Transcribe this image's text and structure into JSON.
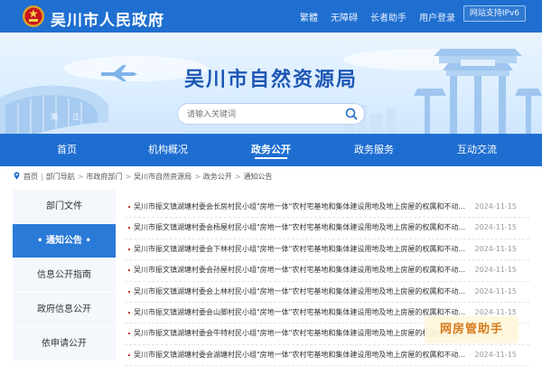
{
  "header": {
    "site_name": "吴川市人民政府",
    "links": [
      "繁體",
      "无障碍",
      "长者助手",
      "用户登录"
    ],
    "ipv6": "网站支持IPv6"
  },
  "banner": {
    "title": "吴川市自然资源局",
    "search_placeholder": "请输入关键词"
  },
  "nav": {
    "items": [
      "首页",
      "机构概况",
      "政务公开",
      "政务服务",
      "互动交流"
    ],
    "active": "政务公开"
  },
  "breadcrumb": [
    "首页",
    "部门导航",
    "市政府部门",
    "吴川市自然资源局",
    "政务公开",
    "通知公告"
  ],
  "sidebar": {
    "items": [
      "部门文件",
      "• 通知公告 •",
      "信息公开指南",
      "政府信息公开",
      "依申请公开"
    ],
    "active_index": 1
  },
  "notices": [
    {
      "title": "吴川市振文镇湖塘村委会长房村民小组\"房地一体\"农村宅基地和集体建设用地及地上房屋的权属和不动...",
      "date": "2024-11-15"
    },
    {
      "title": "吴川市振文镇湖塘村委会杨屋村民小组\"房地一体\"农村宅基地和集体建设用地及地上房屋的权属和不动...",
      "date": "2024-11-15"
    },
    {
      "title": "吴川市振文镇湖塘村委会下林村民小组\"房地一体\"农村宅基地和集体建设用地及地上房屋的权属和不动...",
      "date": "2024-11-15"
    },
    {
      "title": "吴川市振文镇湖塘村委会孙屋村民小组\"房地一体\"农村宅基地和集体建设用地及地上房屋的权属和不动...",
      "date": "2024-11-15"
    },
    {
      "title": "吴川市振文镇湖塘村委会上林村民小组\"房地一体\"农村宅基地和集体建设用地及地上房屋的权属和不动...",
      "date": "2024-11-15"
    },
    {
      "title": "吴川市振文镇湖塘村委会山脚村民小组\"房地一体\"农村宅基地和集体建设用地及地上房屋的权属和不动...",
      "date": "2024-11-15"
    },
    {
      "title": "吴川市振文镇湖塘村委会牛特村民小组\"房地一体\"农村宅基地和集体建设用地及地上房屋的权属和不动...",
      "date": "2024-11-15"
    },
    {
      "title": "吴川市振文镇湖塘村委会湖塘村民小组\"房地一体\"农村宅基地和集体建设用地及地上房屋的权属和不动...",
      "date": "2024-11-15"
    }
  ],
  "watermark": "网房管助手",
  "colors": {
    "primary": "#1e6ed1",
    "active_side": "#2a7ad8",
    "title": "#1d57b5"
  }
}
